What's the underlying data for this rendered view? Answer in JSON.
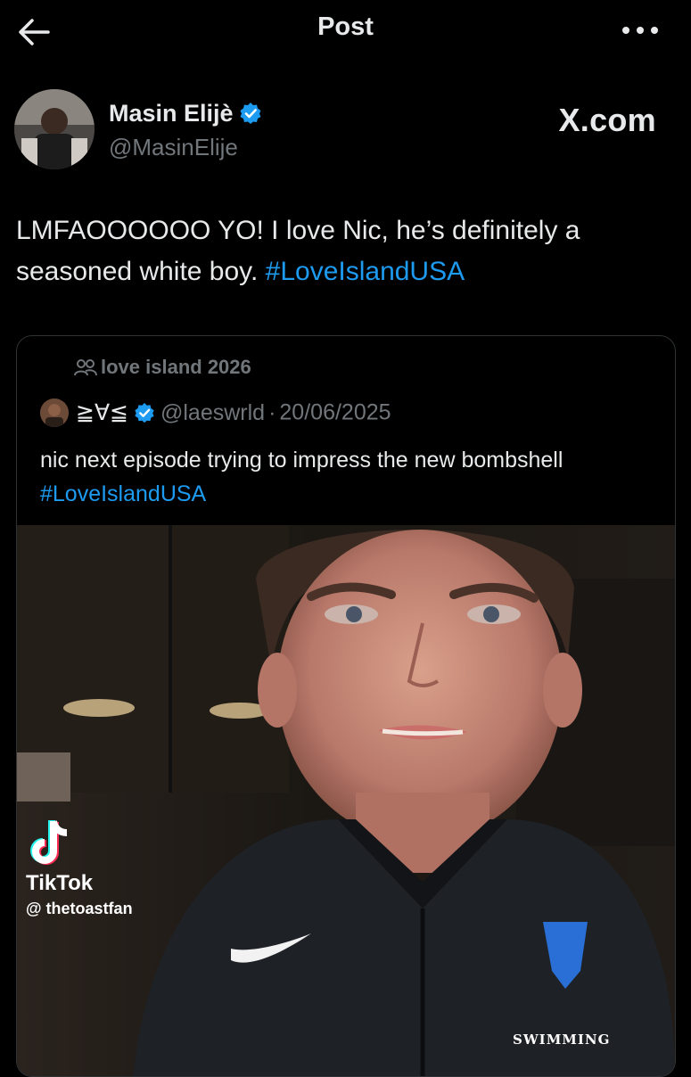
{
  "header": {
    "title": "Post",
    "back_icon": "arrow-left-icon",
    "more_icon": "more-horizontal-icon"
  },
  "author": {
    "display_name": "Masin Elijè",
    "handle": "@MasinElije",
    "verified_icon": "verified-badge-icon",
    "source": "X.com"
  },
  "post": {
    "text": "LMFAOOOOOO YO! I love Nic, he’s definitely a seasoned white boy.",
    "hashtag": "#LoveIslandUSA"
  },
  "quote": {
    "community": "love island 2026",
    "community_icon": "community-people-icon",
    "name": "≧∀≦",
    "handle": "@laeswrld",
    "separator": "·",
    "date": "20/06/2025",
    "text": "nic next episode trying to impress the new bombshell",
    "hashtag": "#LoveIslandUSA"
  },
  "media": {
    "watermark_brand": "TikTok",
    "watermark_user": "@ thetoastfan",
    "shirt_text": "SWIMMING"
  },
  "colors": {
    "background": "#000000",
    "text": "#e7e9ea",
    "secondary": "#71767b",
    "accent": "#1d9bf0",
    "border": "#2f3336"
  }
}
